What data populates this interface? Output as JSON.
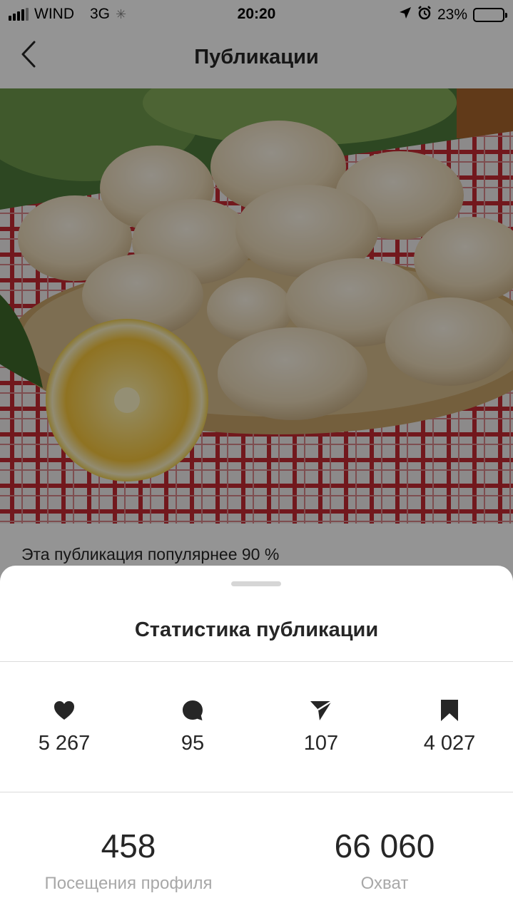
{
  "status_bar": {
    "carrier": "WIND",
    "network": "3G",
    "time": "20:20",
    "battery": "23%",
    "battery_level": 0.23
  },
  "nav": {
    "title": "Публикации"
  },
  "post": {
    "popularity_text": "Эта публикация популярнее 90 %"
  },
  "sheet": {
    "title": "Статистика публикации",
    "metrics": [
      {
        "icon": "heart-icon",
        "value": "5 267"
      },
      {
        "icon": "comment-icon",
        "value": "95"
      },
      {
        "icon": "send-icon",
        "value": "107"
      },
      {
        "icon": "bookmark-icon",
        "value": "4 027"
      }
    ],
    "summary": [
      {
        "value": "458",
        "label": "Посещения профиля"
      },
      {
        "value": "66 060",
        "label": "Охват"
      }
    ]
  },
  "colors": {
    "text": "#262626",
    "muted": "#a8a8a8",
    "divider": "#dbdbdb",
    "overlay": "rgba(0,0,0,0.42)"
  }
}
